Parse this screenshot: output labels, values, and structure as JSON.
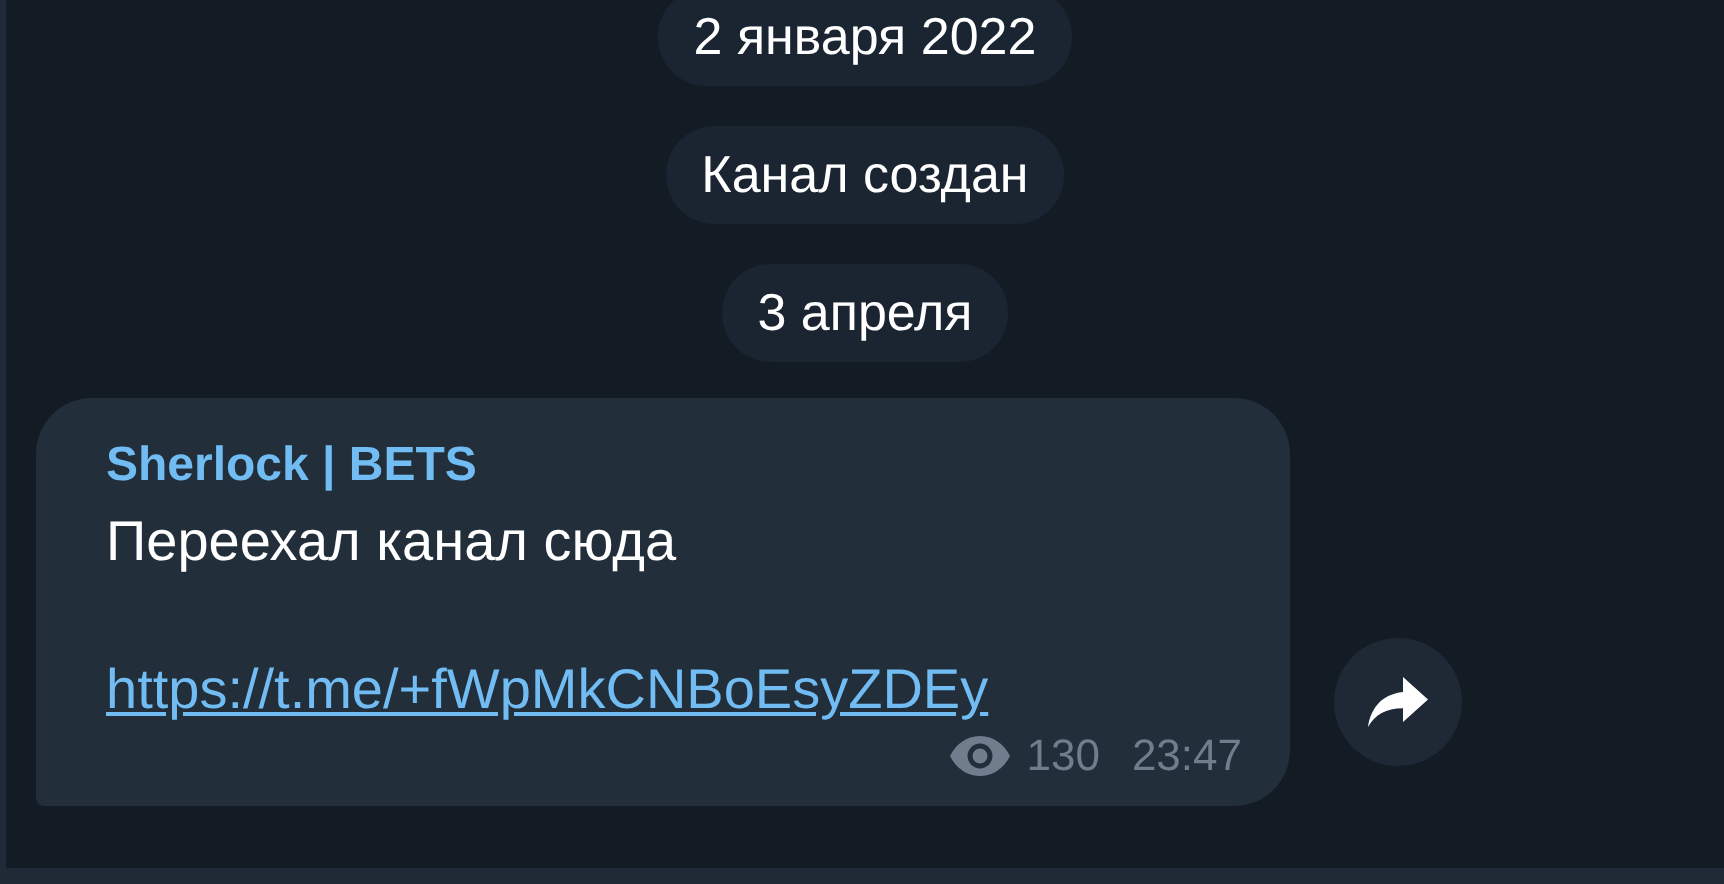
{
  "service_messages": [
    {
      "text": "2 января 2022"
    },
    {
      "text": "Канал создан"
    },
    {
      "text": "3 апреля"
    }
  ],
  "message": {
    "sender": "Sherlock | BETS",
    "text": "Переехал канал сюда",
    "link": "https://t.me/+fWpMkCNBoEsyZDEy",
    "views": "130",
    "time": "23:47"
  }
}
